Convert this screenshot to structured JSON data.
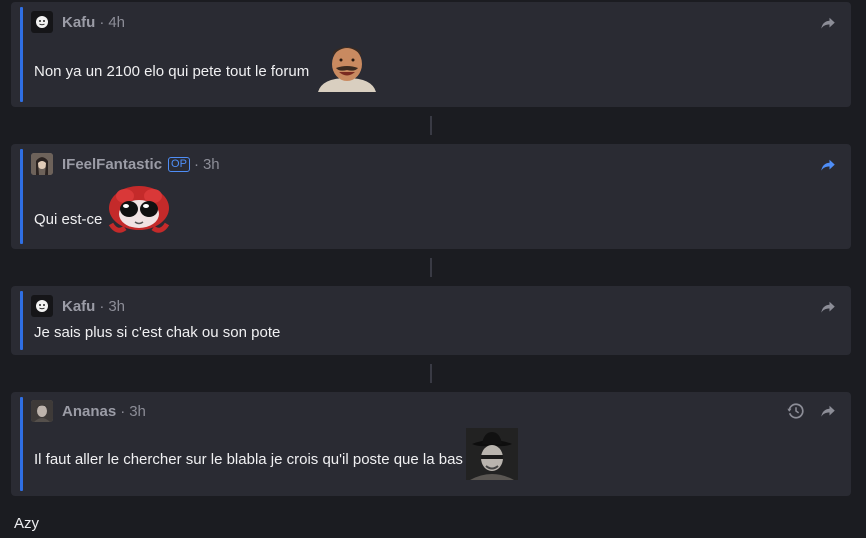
{
  "replies": [
    {
      "username": "Kafu",
      "separator": "·",
      "time": "4h",
      "is_op": false,
      "avatar": "white-ghost-avatar",
      "text": "Non ya un 2100 elo qui pete tout le forum",
      "emote": "laughing-mustache-man-emote"
    },
    {
      "username": "IFeelFantastic",
      "separator": "·",
      "time": "3h",
      "is_op": true,
      "op_label": "OP",
      "avatar": "portrait-avatar",
      "text": "Qui est-ce",
      "emote": "red-creature-sunglasses-emote"
    },
    {
      "username": "Kafu",
      "separator": "·",
      "time": "3h",
      "is_op": false,
      "avatar": "white-ghost-avatar",
      "text": "Je sais plus si c'est chak ou son pote"
    },
    {
      "username": "Ananas",
      "separator": "·",
      "time": "3h",
      "is_op": false,
      "avatar": "portrait-avatar",
      "text": "Il faut aller le chercher sur le blabla je crois qu'il poste que la bas",
      "emote": "cowboy-hat-man-emote",
      "has_history": true
    }
  ],
  "last_message": "Azy",
  "colors": {
    "background": "#1b1c21",
    "card": "#2a2b33",
    "accent": "#2f6fe4",
    "muted": "#8c8d97",
    "share_active": "#4f8ef7",
    "share_idle": "#8c8d97"
  }
}
